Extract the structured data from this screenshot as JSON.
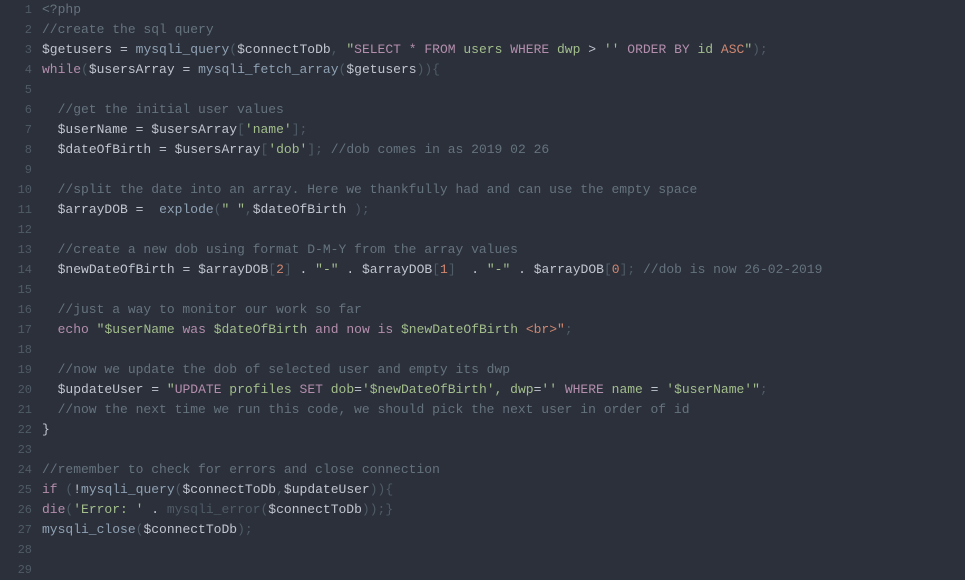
{
  "lines": [
    {
      "n": "1",
      "cls": "php-tag",
      "t": "<?php"
    },
    {
      "n": "2",
      "cls": "comment",
      "t": "//create the sql query"
    },
    {
      "n": "3",
      "raw": true
    },
    {
      "n": "4",
      "raw": "while"
    },
    {
      "n": "5",
      "cls": "",
      "t": ""
    },
    {
      "n": "6",
      "cls": "comment",
      "t": "  //get the initial user values"
    },
    {
      "n": "7",
      "raw": "userName"
    },
    {
      "n": "8",
      "raw": "dateOfBirth"
    },
    {
      "n": "9",
      "cls": "",
      "t": ""
    },
    {
      "n": "10",
      "cls": "comment",
      "t": "  //split the date into an array. Here we thankfully had and can use the empty space"
    },
    {
      "n": "11",
      "raw": "arrayDOB"
    },
    {
      "n": "12",
      "cls": "",
      "t": ""
    },
    {
      "n": "13",
      "cls": "comment",
      "t": "  //create a new dob using format D-M-Y from the array values"
    },
    {
      "n": "14",
      "raw": "newDateOfBirth"
    },
    {
      "n": "15",
      "cls": "",
      "t": ""
    },
    {
      "n": "16",
      "cls": "comment",
      "t": "  //just a way to monitor our work so far"
    },
    {
      "n": "17",
      "raw": "echo"
    },
    {
      "n": "18",
      "cls": "",
      "t": ""
    },
    {
      "n": "19",
      "cls": "comment",
      "t": "  //now we update the dob of selected user and empty its dwp"
    },
    {
      "n": "20",
      "raw": "updateUser"
    },
    {
      "n": "21",
      "cls": "comment",
      "t": "  //now the next time we run this code, we should pick the next user in order of id"
    },
    {
      "n": "22",
      "cls": "variable",
      "t": "}"
    },
    {
      "n": "23",
      "cls": "",
      "t": ""
    },
    {
      "n": "24",
      "cls": "comment",
      "t": "//remember to check for errors and close connection"
    },
    {
      "n": "25",
      "raw": "if"
    },
    {
      "n": "26",
      "raw": "die"
    },
    {
      "n": "27",
      "raw": "close"
    },
    {
      "n": "28",
      "cls": "",
      "t": ""
    },
    {
      "n": "29",
      "cls": "",
      "t": ""
    }
  ],
  "tokens": {
    "phpOpen": "<?php",
    "c_sql": "//create the sql query",
    "getusers": "$getusers",
    "eq": "=",
    "mysqli_query": "mysqli_query",
    "connectToDb": "$connectToDb",
    "selectStr1": "\"",
    "SELECT": "SELECT",
    "star": "*",
    "FROM": "FROM",
    "users": " users ",
    "WHERE": "WHERE",
    "dwp": " dwp ",
    "gt": ">",
    "empty": "''",
    "ORDERBY": "ORDER BY",
    "id": " id ",
    "ASC": "ASC",
    "while": "while",
    "usersArray": "$usersArray",
    "mysqli_fetch_array": "mysqli_fetch_array",
    "c_initial": "//get the initial user values",
    "userName": "$userName",
    "nameStr": "'name'",
    "dateOfBirth": "$dateOfBirth",
    "dobStr": "'dob'",
    "c_dobcomes": "//dob comes in as 2019 02 26",
    "c_split": "//split the date into an array. Here we thankfully had and can use the empty space",
    "arrayDOB": "$arrayDOB",
    "explode": "explode",
    "spaceStr": "\" \"",
    "c_newdob": "//create a new dob using format D-M-Y from the array values",
    "newDateOfBirth": "$newDateOfBirth",
    "n2": "2",
    "n1": "1",
    "n0": "0",
    "dot": ".",
    "dashStr": "\"-\"",
    "c_dobnow": "//dob is now 26-02-2019",
    "c_monitor": "//just a way to monitor our work so far",
    "echo": "echo",
    "echoStr1": "\"$userName",
    "was": "was",
    "and": "and",
    "now": "now",
    "is": "is",
    "br": "<br>\"",
    "c_update": "//now we update the dob of selected user and empty its dwp",
    "updateUser": "$updateUser",
    "UPDATE": "UPDATE",
    "profiles": " profiles ",
    "SET": "SET",
    "dob": " dob",
    "newDobQ": "'$newDateOfBirth'",
    "commaDwp": ", dwp",
    "name": " name ",
    "userQ": "'$userName'",
    "c_nexttime": "//now the next time we run this code, we should pick the next user in order of id",
    "c_remember": "//remember to check for errors and close connection",
    "if": "if",
    "bang": "!",
    "die": "die",
    "errorStr": "'Error: '",
    "mysqli_error": "mysqli_error",
    "mysqli_close": "mysqli_close"
  }
}
